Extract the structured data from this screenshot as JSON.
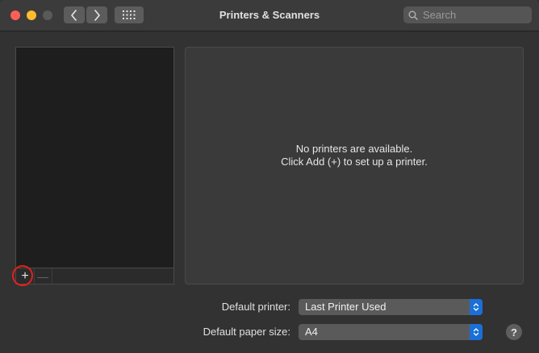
{
  "window": {
    "title": "Printers & Scanners"
  },
  "toolbar": {
    "back_icon": "chevron-left-icon",
    "forward_icon": "chevron-right-icon",
    "grid_icon": "show-all-grid-icon"
  },
  "search": {
    "placeholder": "Search",
    "value": ""
  },
  "printer_list": {
    "items": [],
    "add_label": "+",
    "remove_label": "—"
  },
  "detail": {
    "line1": "No printers are available.",
    "line2": "Click Add (+) to set up a printer."
  },
  "form": {
    "default_printer_label": "Default printer:",
    "default_printer_value": "Last Printer Used",
    "paper_size_label": "Default paper size:",
    "paper_size_value": "A4"
  },
  "help": {
    "label": "?"
  },
  "colors": {
    "close": "#ff5f57",
    "minimize": "#febc2e",
    "accent": "#1a6fd9",
    "highlight_ring": "#e3201b"
  }
}
